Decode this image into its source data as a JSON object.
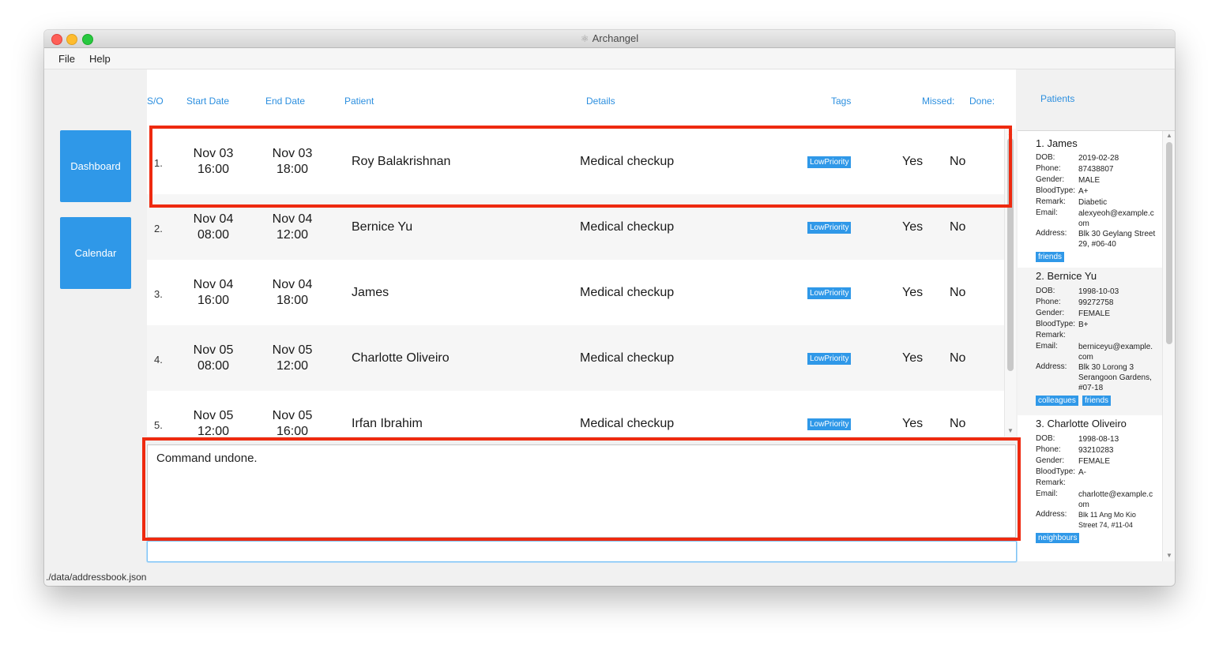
{
  "window": {
    "title": "Archangel"
  },
  "menu": {
    "file": "File",
    "help": "Help"
  },
  "sidebar": {
    "dashboard": "Dashboard",
    "calendar": "Calendar"
  },
  "table": {
    "headers": {
      "so": "S/O",
      "start_date": "Start Date",
      "end_date": "End Date",
      "patient": "Patient",
      "details": "Details",
      "tags": "Tags",
      "missed": "Missed:",
      "done": "Done:"
    },
    "rows": [
      {
        "index": "1.",
        "start": [
          "Nov 03",
          "16:00"
        ],
        "end": [
          "Nov 03",
          "18:00"
        ],
        "patient": "Roy Balakrishnan",
        "details": "Medical checkup",
        "tag": "LowPriority",
        "missed": "Yes",
        "done": "No"
      },
      {
        "index": "2.",
        "start": [
          "Nov 04",
          "08:00"
        ],
        "end": [
          "Nov 04",
          "12:00"
        ],
        "patient": "Bernice Yu",
        "details": "Medical checkup",
        "tag": "LowPriority",
        "missed": "Yes",
        "done": "No"
      },
      {
        "index": "3.",
        "start": [
          "Nov 04",
          "16:00"
        ],
        "end": [
          "Nov 04",
          "18:00"
        ],
        "patient": "James",
        "details": "Medical checkup",
        "tag": "LowPriority",
        "missed": "Yes",
        "done": "No"
      },
      {
        "index": "4.",
        "start": [
          "Nov 05",
          "08:00"
        ],
        "end": [
          "Nov 05",
          "12:00"
        ],
        "patient": "Charlotte Oliveiro",
        "details": "Medical checkup",
        "tag": "LowPriority",
        "missed": "Yes",
        "done": "No"
      },
      {
        "index": "5.",
        "start": [
          "Nov 05",
          "12:00"
        ],
        "end": [
          "Nov 05",
          "16:00"
        ],
        "patient": "Irfan Ibrahim",
        "details": "Medical checkup",
        "tag": "LowPriority",
        "missed": "Yes",
        "done": "No"
      }
    ]
  },
  "result": {
    "text": "Command undone."
  },
  "command": {
    "value": ""
  },
  "status": {
    "path": "./data/addressbook.json"
  },
  "patients": {
    "title": "Patients",
    "labels": {
      "dob": "DOB:",
      "phone": "Phone:",
      "gender": "Gender:",
      "bloodtype": "BloodType:",
      "remark": "Remark:",
      "email": "Email:",
      "address": "Address:"
    },
    "items": [
      {
        "name": "1. James",
        "dob": "2019-02-28",
        "phone": "87438807",
        "gender": "MALE",
        "bloodtype": "A+",
        "remark": "Diabetic",
        "email": "alexyeoh@example.com",
        "address": "Blk 30 Geylang Street 29, #06-40",
        "tags": [
          "friends"
        ]
      },
      {
        "name": "2. Bernice Yu",
        "dob": "1998-10-03",
        "phone": "99272758",
        "gender": "FEMALE",
        "bloodtype": "B+",
        "remark": "",
        "email": "berniceyu@example.com",
        "address": "Blk 30 Lorong 3 Serangoon Gardens, #07-18",
        "tags": [
          "colleagues",
          "friends"
        ]
      },
      {
        "name": "3. Charlotte Oliveiro",
        "dob": "1998-08-13",
        "phone": "93210283",
        "gender": "FEMALE",
        "bloodtype": "A-",
        "remark": "",
        "email": "charlotte@example.com",
        "address": "Blk 11 Ang Mo Kio Street 74, #11-04",
        "tags": [
          "neighbours"
        ]
      }
    ]
  },
  "colors": {
    "accent": "#2f98e8",
    "highlight": "#ee2a10",
    "header_text": "#2c8fdf"
  }
}
